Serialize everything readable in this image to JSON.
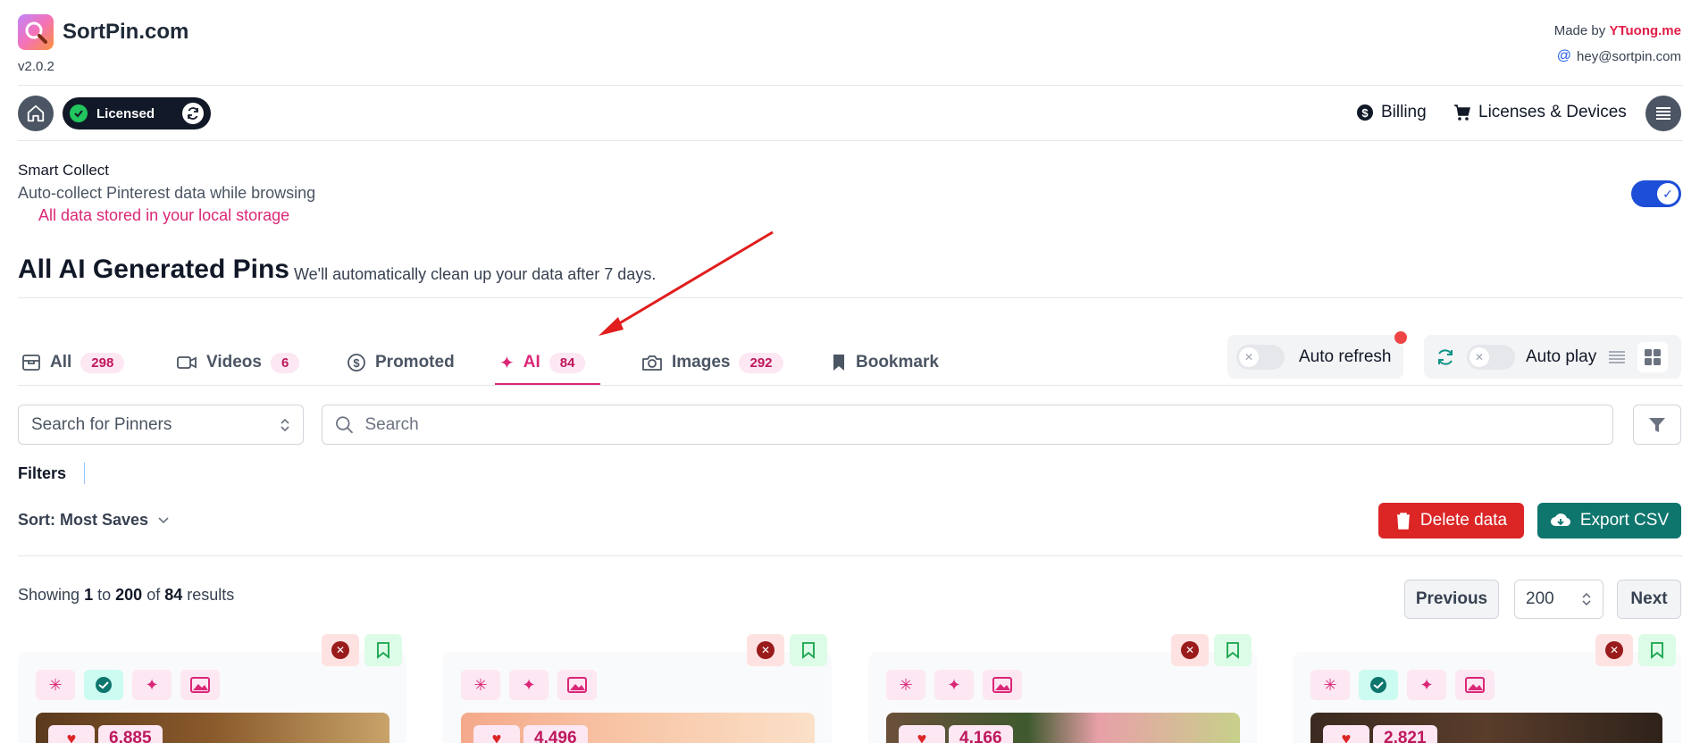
{
  "header": {
    "brand": "SortPin.com",
    "version": "v2.0.2",
    "made_by_prefix": "Made by",
    "made_by_name": "YTuong.me",
    "email": "hey@sortpin.com"
  },
  "nav": {
    "licensed_label": "Licensed",
    "billing_label": "Billing",
    "licenses_label": "Licenses & Devices"
  },
  "smart_collect": {
    "title": "Smart Collect",
    "description": "Auto-collect Pinterest data while browsing",
    "note": "All data stored in your local storage",
    "enabled": true
  },
  "page": {
    "title": "All AI Generated Pins",
    "subtitle": "We'll automatically clean up your data after 7 days."
  },
  "tabs": [
    {
      "label": "All",
      "count": "298",
      "icon": "inbox-icon"
    },
    {
      "label": "Videos",
      "count": "6",
      "icon": "video-icon"
    },
    {
      "label": "Promoted",
      "count": "",
      "icon": "dollar-icon"
    },
    {
      "label": "AI",
      "count": "84",
      "icon": "sparkles-icon",
      "active": true
    },
    {
      "label": "Images",
      "count": "292",
      "icon": "camera-icon"
    },
    {
      "label": "Bookmark",
      "count": "",
      "icon": "bookmark-icon"
    }
  ],
  "controls": {
    "auto_refresh_label": "Auto refresh",
    "auto_play_label": "Auto play"
  },
  "search": {
    "pinner_placeholder": "Search for Pinners",
    "search_placeholder": "Search"
  },
  "filters_label": "Filters",
  "sort_label": "Sort: Most Saves",
  "actions": {
    "delete_label": "Delete data",
    "export_label": "Export CSV"
  },
  "pagination": {
    "showing_prefix": "Showing",
    "from": "1",
    "to_word": "to",
    "to": "200",
    "of_word": "of",
    "total": "84",
    "suffix": "results",
    "previous_label": "Previous",
    "per_page": "200",
    "next_label": "Next"
  },
  "cards": [
    {
      "likes": "6,885",
      "verified": true
    },
    {
      "likes": "4,496",
      "verified": false
    },
    {
      "likes": "4,166",
      "verified": false
    },
    {
      "likes": "2,821",
      "verified": true
    }
  ],
  "colors": {
    "accent_pink": "#db2777",
    "delete_red": "#dc2626",
    "export_teal": "#0f766e",
    "toggle_blue": "#1d4ed8"
  }
}
